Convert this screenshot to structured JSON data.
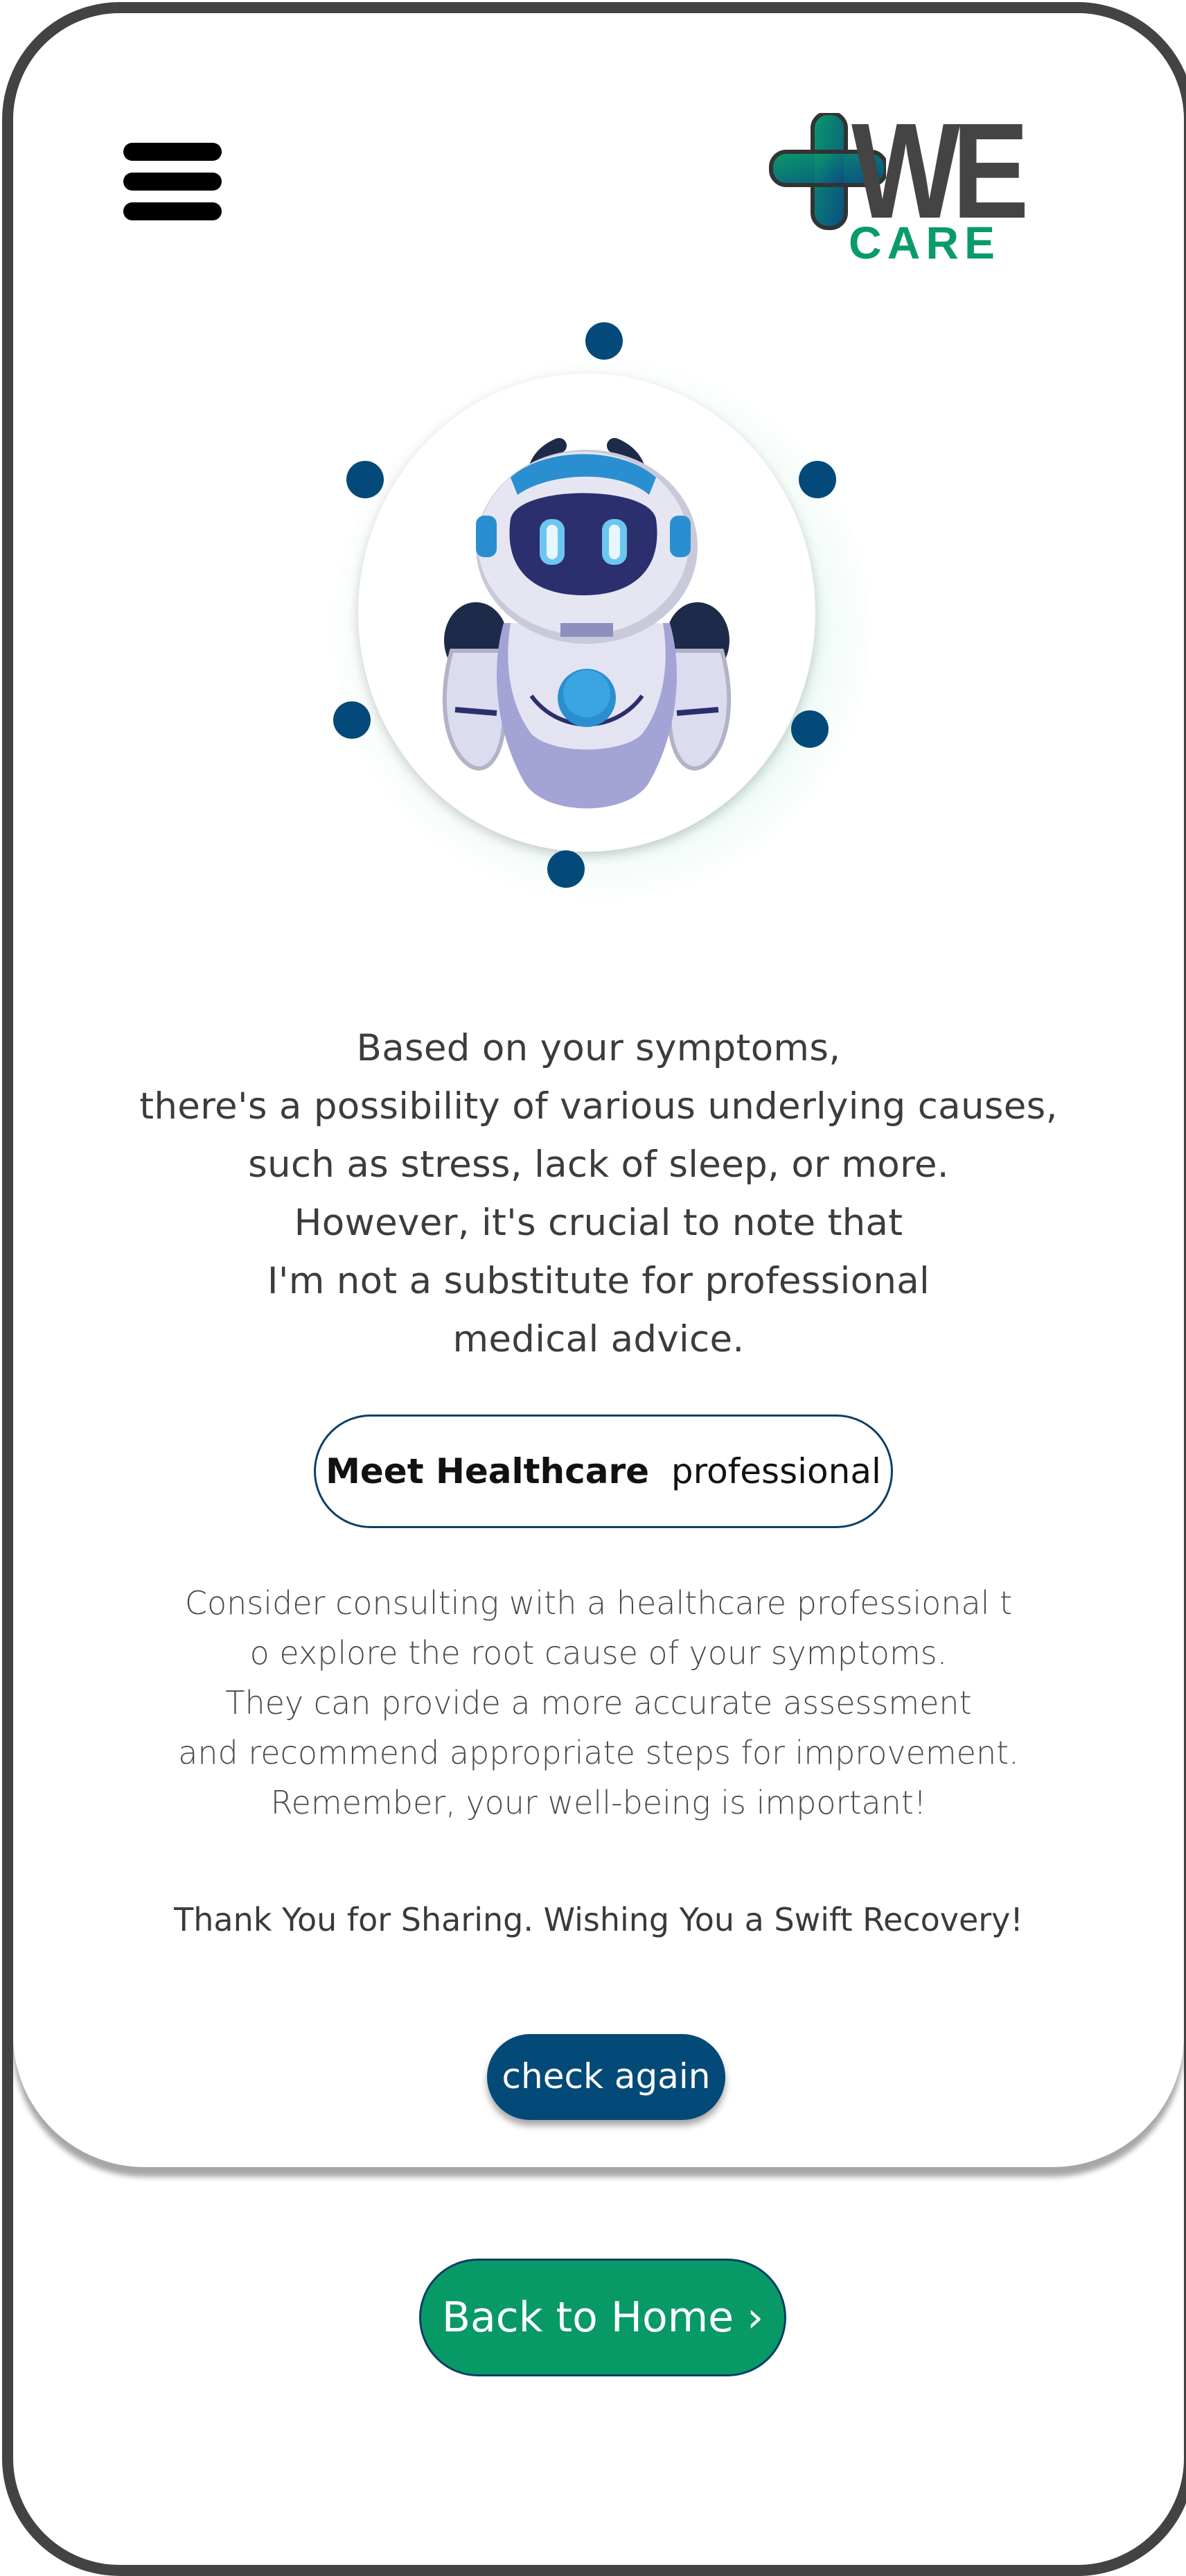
{
  "header": {
    "menu_icon": "hamburger-menu-icon",
    "logo": {
      "mark": "WE",
      "sub": "CARE",
      "colors": {
        "text": "#444444",
        "care": "#0a9b6a",
        "cross_start": "#0b9a6a",
        "cross_end": "#0a4b84"
      }
    }
  },
  "robot": {
    "icon": "robot-assistant-icon",
    "glow_color": "#4ec7a0",
    "dot_color": "#034a7a"
  },
  "main": {
    "message_lines": [
      "Based on your symptoms,",
      "there's a possibility of various underlying causes,",
      "such as stress, lack of sleep, or more.",
      "However, it's crucial to note that",
      "I'm not a substitute for professional",
      "medical advice."
    ],
    "meet_button": {
      "bold": "Meet Healthcare",
      "rest": "professional"
    },
    "advice_lines": [
      "Consider consulting with a healthcare professional t",
      "o explore the root cause of your symptoms.",
      "They can provide a more accurate assessment",
      "and recommend appropriate steps for improvement.",
      "Remember, your well-being is important!"
    ],
    "thanks": "Thank You for Sharing. Wishing You a Swift Recovery!",
    "check_again": "check again"
  },
  "footer": {
    "home_button": "Back to  Home ›"
  },
  "colors": {
    "primary_blue": "#044a78",
    "primary_green": "#089a66",
    "frame": "#434343"
  }
}
